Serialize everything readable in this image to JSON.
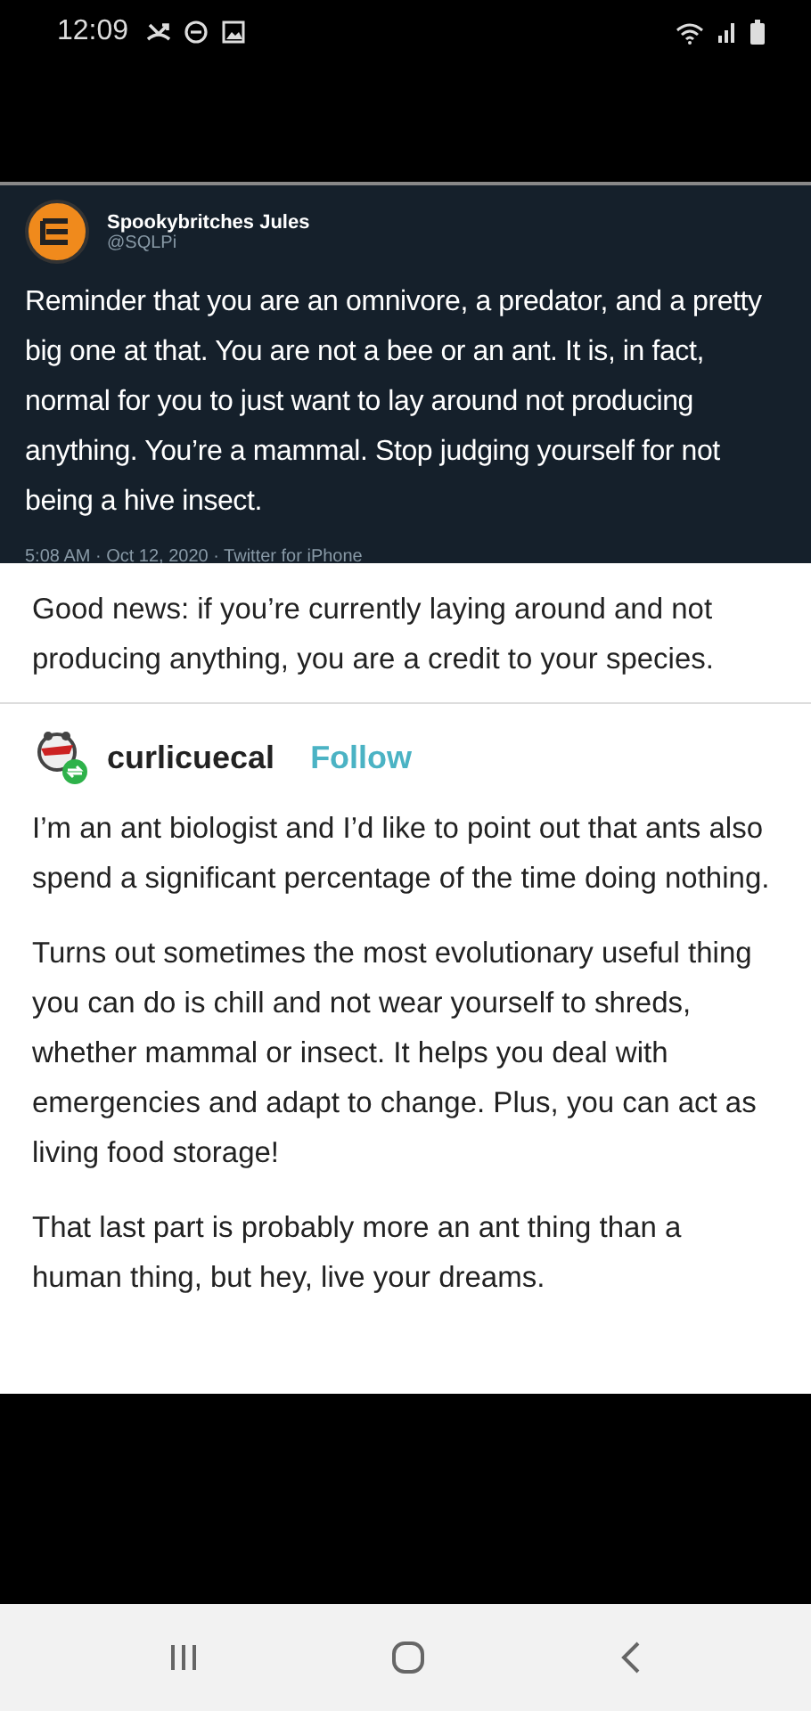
{
  "status_bar": {
    "time": "12:09"
  },
  "tweet": {
    "name": "Spookybritches Jules",
    "handle": "@SQLPi",
    "text": "Reminder that you are an omnivore, a predator, and a pretty big one at that. You are not a bee or an ant. It is, in fact, normal for you to just want to lay around not producing anything. You’re a mammal. Stop judging yourself for not being a hive insect.",
    "meta": "5:08 AM · Oct 12, 2020 · Twitter for iPhone"
  },
  "post": {
    "text": "Good news: if you’re currently laying around and not producing anything, you are a credit to your species."
  },
  "reblog": {
    "username": "curlicuecal",
    "follow": "Follow",
    "paragraphs": [
      "I’m an ant biologist and I’d like to point out that ants also spend a significant percentage of the time doing nothing.",
      "Turns out sometimes the most evolutionary useful thing you can do is chill and not wear yourself to shreds, whether mammal or insect. It helps you deal with emergencies and adapt to change. Plus, you can act as living food storage!",
      "That last part is probably more an ant thing than a human thing, but hey, live your dreams."
    ]
  }
}
